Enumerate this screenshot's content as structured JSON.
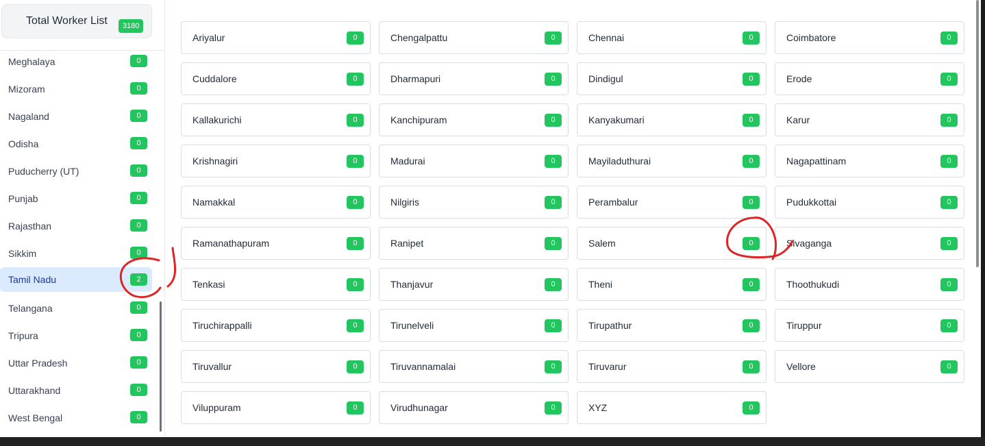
{
  "sidebar": {
    "total_label": "Total Worker List",
    "total_count": "3180",
    "states": [
      {
        "name": "Meghalaya",
        "count": "0"
      },
      {
        "name": "Mizoram",
        "count": "0"
      },
      {
        "name": "Nagaland",
        "count": "0"
      },
      {
        "name": "Odisha",
        "count": "0"
      },
      {
        "name": "Puducherry (UT)",
        "count": "0"
      },
      {
        "name": "Punjab",
        "count": "0"
      },
      {
        "name": "Rajasthan",
        "count": "0"
      },
      {
        "name": "Sikkim",
        "count": "0"
      },
      {
        "name": "Tamil Nadu",
        "count": "2",
        "active": true
      },
      {
        "name": "Telangana",
        "count": "0"
      },
      {
        "name": "Tripura",
        "count": "0"
      },
      {
        "name": "Uttar Pradesh",
        "count": "0"
      },
      {
        "name": "Uttarakhand",
        "count": "0"
      },
      {
        "name": "West Bengal",
        "count": "0"
      }
    ]
  },
  "main": {
    "districts": [
      {
        "name": "Ariyalur",
        "count": "0"
      },
      {
        "name": "Chengalpattu",
        "count": "0"
      },
      {
        "name": "Chennai",
        "count": "0"
      },
      {
        "name": "Coimbatore",
        "count": "0"
      },
      {
        "name": "Cuddalore",
        "count": "0"
      },
      {
        "name": "Dharmapuri",
        "count": "0"
      },
      {
        "name": "Dindigul",
        "count": "0"
      },
      {
        "name": "Erode",
        "count": "0"
      },
      {
        "name": "Kallakurichi",
        "count": "0"
      },
      {
        "name": "Kanchipuram",
        "count": "0"
      },
      {
        "name": "Kanyakumari",
        "count": "0"
      },
      {
        "name": "Karur",
        "count": "0"
      },
      {
        "name": "Krishnagiri",
        "count": "0"
      },
      {
        "name": "Madurai",
        "count": "0"
      },
      {
        "name": "Mayiladuthurai",
        "count": "0"
      },
      {
        "name": "Nagapattinam",
        "count": "0"
      },
      {
        "name": "Namakkal",
        "count": "0"
      },
      {
        "name": "Nilgiris",
        "count": "0"
      },
      {
        "name": "Perambalur",
        "count": "0"
      },
      {
        "name": "Pudukkottai",
        "count": "0"
      },
      {
        "name": "Ramanathapuram",
        "count": "0"
      },
      {
        "name": "Ranipet",
        "count": "0"
      },
      {
        "name": "Salem",
        "count": "0"
      },
      {
        "name": "Sivaganga",
        "count": "0"
      },
      {
        "name": "Tenkasi",
        "count": "0"
      },
      {
        "name": "Thanjavur",
        "count": "0"
      },
      {
        "name": "Theni",
        "count": "0"
      },
      {
        "name": "Thoothukudi",
        "count": "0"
      },
      {
        "name": "Tiruchirappalli",
        "count": "0"
      },
      {
        "name": "Tirunelveli",
        "count": "0"
      },
      {
        "name": "Tirupathur",
        "count": "0"
      },
      {
        "name": "Tiruppur",
        "count": "0"
      },
      {
        "name": "Tiruvallur",
        "count": "0"
      },
      {
        "name": "Tiruvannamalai",
        "count": "0"
      },
      {
        "name": "Tiruvarur",
        "count": "0"
      },
      {
        "name": "Vellore",
        "count": "0"
      },
      {
        "name": "Viluppuram",
        "count": "0"
      },
      {
        "name": "Virudhunagar",
        "count": "0"
      },
      {
        "name": "XYZ",
        "count": "0"
      }
    ]
  },
  "colors": {
    "badge": "#22c55e",
    "active_state_bg": "#dbeafe",
    "annotation": "#dc2626"
  }
}
